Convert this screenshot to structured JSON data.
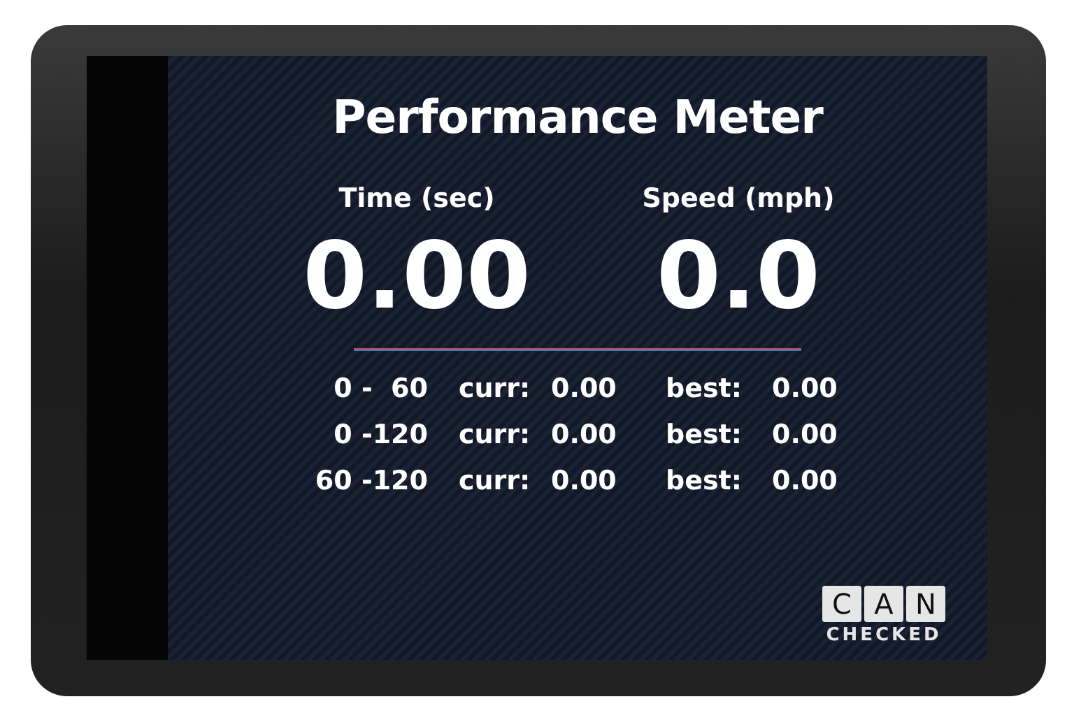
{
  "title": "Performance Meter",
  "readouts": [
    {
      "label": "Time (sec)",
      "value": "0.00"
    },
    {
      "label": "Speed (mph)",
      "value": "0.0"
    }
  ],
  "rows": [
    {
      "range": "0 -  60",
      "curr_label": "curr:",
      "curr_value": "0.00",
      "best_label": "best:",
      "best_value": "0.00"
    },
    {
      "range": "0 -120",
      "curr_label": "curr:",
      "curr_value": "0.00",
      "best_label": "best:",
      "best_value": "0.00"
    },
    {
      "range": "60 -120",
      "curr_label": "curr:",
      "curr_value": "0.00",
      "best_label": "best:",
      "best_value": "0.00"
    }
  ],
  "logo": {
    "letters": [
      "C",
      "A",
      "N"
    ],
    "subtitle": "CHECKED"
  }
}
